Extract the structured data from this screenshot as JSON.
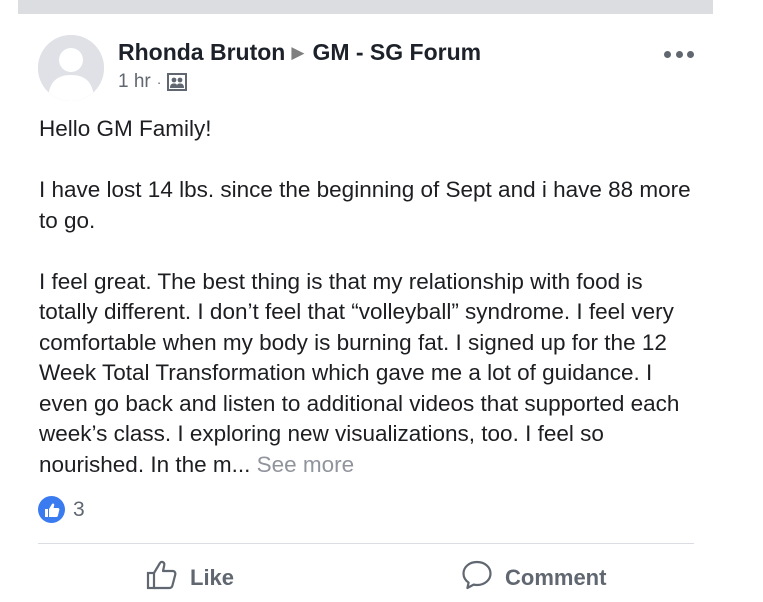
{
  "post": {
    "author": "Rhonda Bruton",
    "group": "GM - SG Forum",
    "arrow": "▶",
    "timestamp": "1 hr",
    "separator": "·",
    "privacy_icon": "group-privacy-icon",
    "more_icon": "more-options-icon",
    "paragraphs": [
      "Hello GM Family!",
      "I have lost 14 lbs. since the beginning of Sept and i have 88 more to go.",
      "I feel great.  The best thing is that my relationship with food is totally different.  I don’t feel that “volleyball” syndrome.  I feel very comfortable when my body is burning fat.  I signed up for the 12 Week Total Transformation which gave me a lot of guidance.  I even go back and listen to additional videos that supported each week’s class.  I exploring new visualizations, too.  I feel so nourished.  In the m..."
    ],
    "see_more": "See more"
  },
  "reactions": {
    "icon": "thumbs-up-icon",
    "count": "3",
    "color": "#3b7bf0"
  },
  "actions": {
    "like_label": "Like",
    "comment_label": "Comment"
  },
  "colors": {
    "top_bar": "#dcdde0",
    "text": "#1c1e21",
    "muted": "#606770"
  }
}
